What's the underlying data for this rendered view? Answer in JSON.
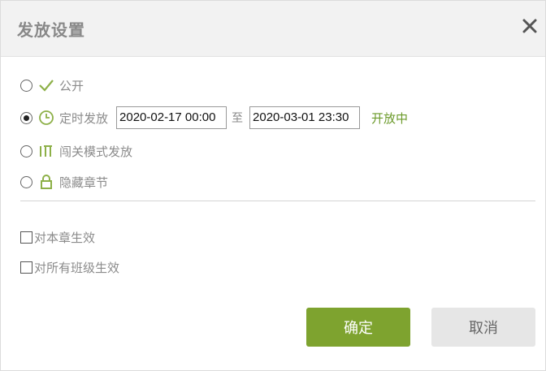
{
  "dialog": {
    "title": "发放设置",
    "close_icon": "close-icon"
  },
  "options": [
    {
      "id": "public",
      "label": "公开",
      "icon": "check-icon",
      "checked": false
    },
    {
      "id": "timed",
      "label": "定时发放",
      "icon": "clock-icon",
      "checked": true
    },
    {
      "id": "level",
      "label": "闯关模式发放",
      "icon": "level-mode-icon",
      "checked": false
    },
    {
      "id": "hidden",
      "label": "隐藏章节",
      "icon": "lock-icon",
      "checked": false
    }
  ],
  "timed": {
    "start": "2020-02-17 00:00",
    "separator": "至",
    "end": "2020-03-01 23:30",
    "status": "开放中"
  },
  "checkboxes": [
    {
      "id": "this-chapter",
      "label": "对本章生效",
      "checked": false
    },
    {
      "id": "all-classes",
      "label": "对所有班级生效",
      "checked": false
    }
  ],
  "buttons": {
    "ok": "确定",
    "cancel": "取消"
  },
  "colors": {
    "accent": "#7ea32f",
    "status": "#6b9a2a",
    "icon": "#8db048"
  }
}
